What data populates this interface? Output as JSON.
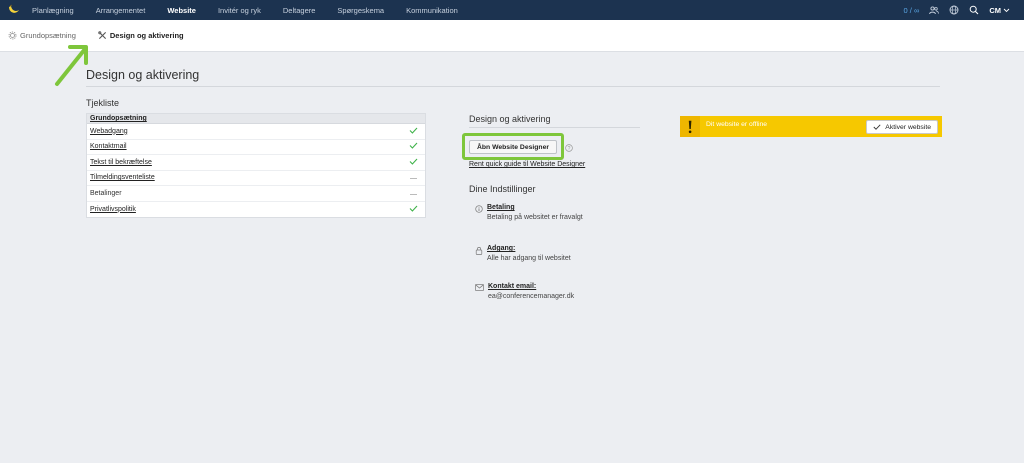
{
  "topnav": {
    "items": [
      {
        "label": "Planlægning"
      },
      {
        "label": "Arrangementet"
      },
      {
        "label": "Website",
        "active": true
      },
      {
        "label": "Invitér og ryk"
      },
      {
        "label": "Deltagere"
      },
      {
        "label": "Spørgeskema"
      },
      {
        "label": "Kommunikation"
      }
    ],
    "counter": "0 / ∞",
    "user": "CM"
  },
  "subnav": {
    "items": [
      {
        "label": "Grundopsætning",
        "icon": "gear-icon"
      },
      {
        "label": "Design og aktivering",
        "icon": "tools-icon",
        "active": true
      }
    ]
  },
  "page": {
    "title": "Design og aktivering"
  },
  "checklist": {
    "title": "Tjekliste",
    "header": "Grundopsætning",
    "rows": [
      {
        "label": "Webadgang",
        "status": "done",
        "link": true
      },
      {
        "label": "Kontaktmail",
        "status": "done",
        "link": true
      },
      {
        "label": "Tekst til bekræftelse",
        "status": "done",
        "link": true
      },
      {
        "label": "Tilmeldingsventeliste",
        "status": "none",
        "link": true
      },
      {
        "label": "Betalinger",
        "status": "none",
        "link": false
      },
      {
        "label": "Privatlivspolitik",
        "status": "done",
        "link": true
      }
    ]
  },
  "design": {
    "title": "Design og aktivering",
    "open_button": "Åbn Website Designer",
    "guide_link": "Rent quick guide til Website Designer",
    "settings_title": "Dine Indstillinger",
    "settings": [
      {
        "icon": "info-icon",
        "label": "Betaling",
        "value": "Betaling på websitet er fravalgt"
      },
      {
        "icon": "lock-icon",
        "label": "Adgang:",
        "value": "Alle har adgang til websitet"
      },
      {
        "icon": "mail-icon",
        "label": "Kontakt email:",
        "value": "ea@conferencemanager.dk"
      }
    ]
  },
  "status_banner": {
    "text": "Dit website er offline",
    "button": "Aktiver website"
  },
  "colors": {
    "nav_bg": "#1c3350",
    "highlight": "#7ec63b",
    "banner": "#f6c800",
    "check": "#3fb24a"
  }
}
